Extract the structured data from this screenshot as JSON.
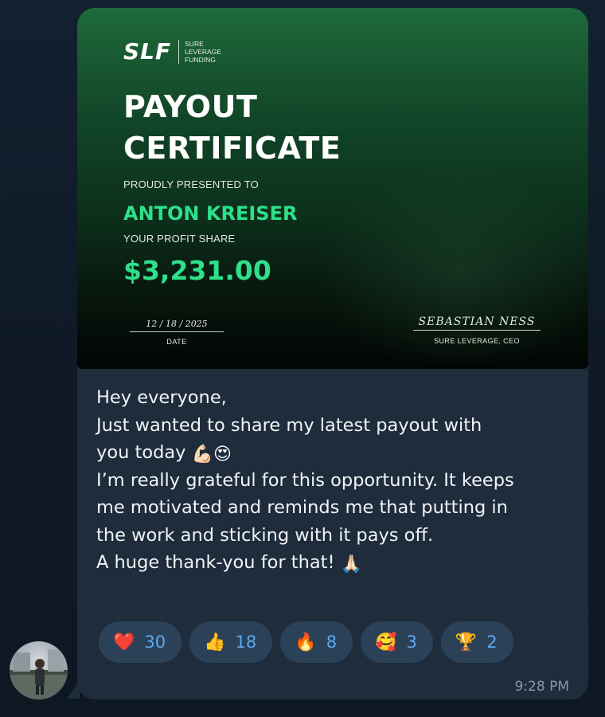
{
  "certificate": {
    "logo_mark": "SLF",
    "logo_text": [
      "SURE",
      "LEVERAGE",
      "FUNDING"
    ],
    "title_line1": "PAYOUT",
    "title_line2": "CERTIFICATE",
    "presented_label": "PROUDLY PRESENTED TO",
    "recipient": "ANTON KREISER",
    "profit_label": "YOUR PROFIT SHARE",
    "amount": "$3,231.00",
    "date_value": "12 / 18 / 2025",
    "date_caption": "DATE",
    "signature": "SEBASTIAN NESS",
    "signature_caption": "SURE LEVERAGE, CEO"
  },
  "message": {
    "line1": "Hey everyone,",
    "line2": "Just wanted to share my latest payout with",
    "line3": "you today",
    "line3_emojis": "💪🏻😍",
    "line4": "I’m really grateful for this opportunity. It keeps",
    "line5": "me motivated and reminds me that putting in",
    "line6": "the work and sticking with it pays off.",
    "line7": "A huge thank-you for that!",
    "line7_emoji": "🙏🏻"
  },
  "reactions": [
    {
      "emoji": "❤️",
      "count": "30"
    },
    {
      "emoji": "👍",
      "count": "18"
    },
    {
      "emoji": "🔥",
      "count": "8"
    },
    {
      "emoji": "🥰",
      "count": "3"
    },
    {
      "emoji": "🏆",
      "count": "2"
    }
  ],
  "time": "9:28 PM",
  "colors": {
    "accent_green": "#2ee08a",
    "reaction_count": "#5ca9ef",
    "bubble": "#1e2c3b"
  }
}
